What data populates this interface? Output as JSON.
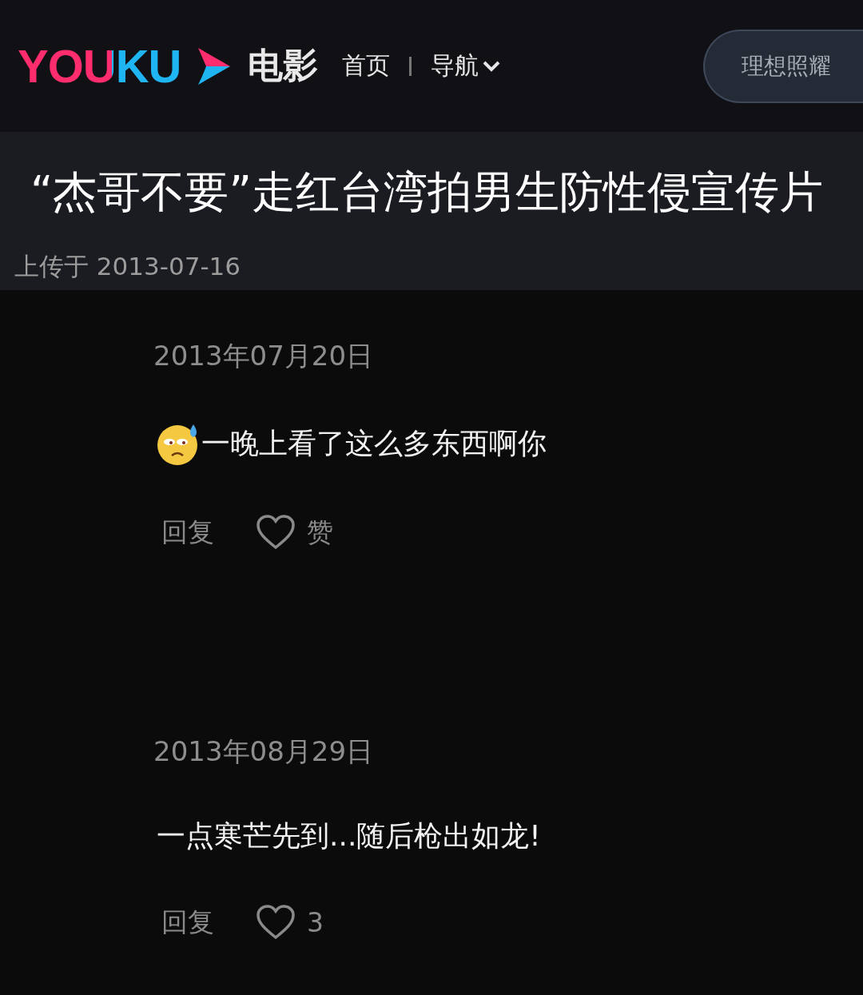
{
  "header": {
    "logo": "YOUKU",
    "channel": "电影",
    "nav": [
      {
        "label": "首页",
        "kind": "link"
      },
      {
        "label": "导航",
        "kind": "dropdown"
      }
    ],
    "search": {
      "placeholder": "理想照耀"
    }
  },
  "video": {
    "title": "“杰哥不要”走红台湾拍男生防性侵宣传片",
    "upload": "上传于 2013-07-16"
  },
  "comments": [
    {
      "date": "2013年07月20日",
      "emoji": true,
      "text": "一晚上看了这么多东西啊你",
      "reply": "回复",
      "likes": "赞"
    },
    {
      "date": "2013年08月29日",
      "emoji": false,
      "text": "一点寒芒先到...随后枪出如龙!",
      "reply": "回复",
      "likes": "3"
    }
  ]
}
